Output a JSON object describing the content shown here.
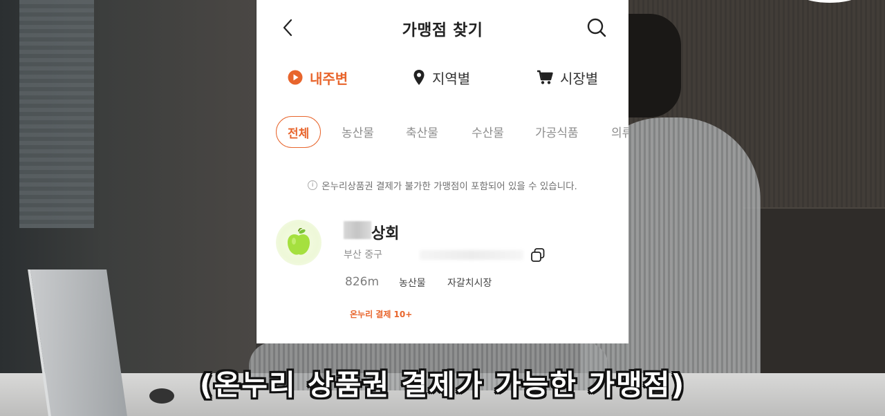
{
  "header": {
    "title": "가맹점 찾기",
    "back_icon": "chevron-left-icon",
    "search_icon": "search-icon"
  },
  "tabs": [
    {
      "label": "내주변",
      "icon": "play-circle-icon",
      "active": true
    },
    {
      "label": "지역별",
      "icon": "map-pin-icon",
      "active": false
    },
    {
      "label": "시장별",
      "icon": "cart-icon",
      "active": false
    }
  ],
  "categories": [
    {
      "label": "전체",
      "active": true
    },
    {
      "label": "농산물",
      "active": false
    },
    {
      "label": "축산물",
      "active": false
    },
    {
      "label": "수산물",
      "active": false
    },
    {
      "label": "가공식품",
      "active": false
    },
    {
      "label": "의류",
      "active": false
    }
  ],
  "notice": {
    "text": "온누리상품권 결제가 불가한 가맹점이 포함되어 있을 수 있습니다.",
    "icon": "info-icon"
  },
  "store": {
    "name": "상회",
    "address": "부산 중구",
    "distance": "826m",
    "tags": [
      "농산물",
      "자갈치시장"
    ],
    "badge": "온누리 결제 10+",
    "thumb_icon": "apple-icon",
    "copy_icon": "copy-icon"
  },
  "subtitle": "(온누리 상품권 결제가 가능한 가맹점)",
  "colors": {
    "accent": "#e8652c",
    "apple": "#a5e03f"
  }
}
